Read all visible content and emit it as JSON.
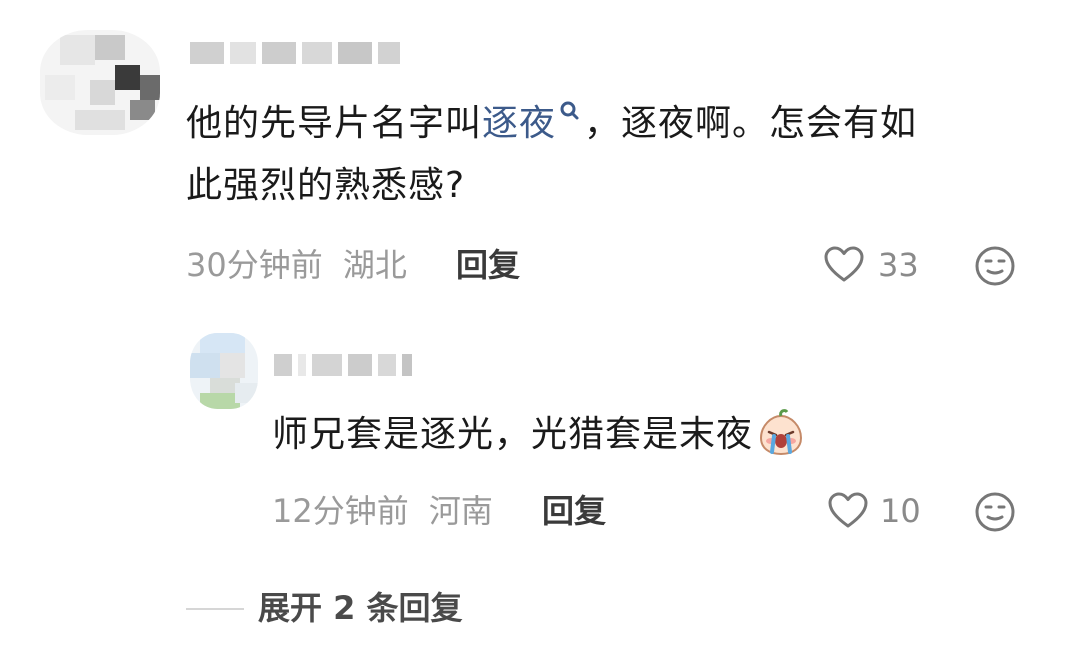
{
  "comment": {
    "text_line1_before": "他的先导片名字叫",
    "text_link": "逐夜",
    "text_line1_after": "，逐夜啊。怎会有如",
    "text_line2": "此强烈的熟悉感?",
    "time": "30分钟前",
    "location": "湖北",
    "reply_label": "回复",
    "likes": "33"
  },
  "reply": {
    "text": "师兄套是逐光，光猎套是末夜",
    "time": "12分钟前",
    "location": "河南",
    "reply_label": "回复",
    "likes": "10"
  },
  "expand": {
    "label": "展开 2 条回复"
  },
  "icons": {
    "like": "heart-outline-icon",
    "react": "neutral-face-icon",
    "search": "search-icon",
    "sticker": "crying-peach-sticker"
  },
  "colors": {
    "text": "#1a1a1a",
    "link": "#3c5a8a",
    "meta": "#9a9a9a",
    "icon": "#777777"
  }
}
